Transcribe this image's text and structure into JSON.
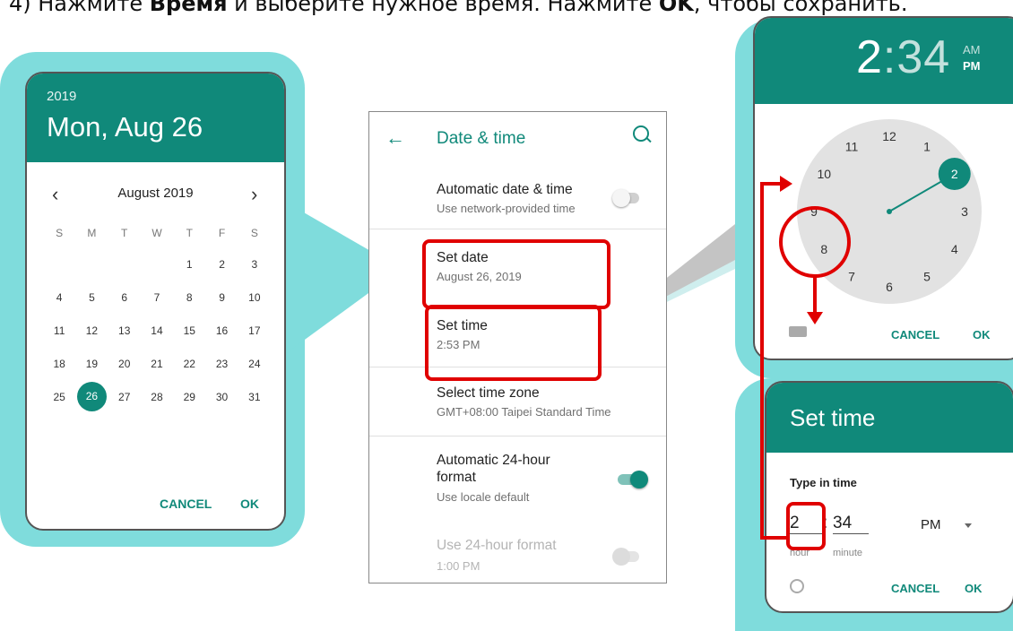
{
  "caption": {
    "prefix": "4) Нажмите ",
    "bold1": "Время",
    "middle": " и выберите нужное время. Нажмите ",
    "bold2": "OK",
    "suffix": ", чтобы сохранить."
  },
  "date_picker": {
    "year": "2019",
    "date": "Mon, Aug 26",
    "month_label": "August 2019",
    "weekdays": [
      "S",
      "M",
      "T",
      "W",
      "T",
      "F",
      "S"
    ],
    "weeks": [
      [
        "",
        "",
        "",
        "",
        "1",
        "2",
        "3"
      ],
      [
        "4",
        "5",
        "6",
        "7",
        "8",
        "9",
        "10"
      ],
      [
        "11",
        "12",
        "13",
        "14",
        "15",
        "16",
        "17"
      ],
      [
        "18",
        "19",
        "20",
        "21",
        "22",
        "23",
        "24"
      ],
      [
        "25",
        "26",
        "27",
        "28",
        "29",
        "30",
        "31"
      ]
    ],
    "selected_day": "26",
    "prev_icon": "‹",
    "next_icon": "›",
    "cancel": "CANCEL",
    "ok": "OK"
  },
  "settings": {
    "back_icon": "←",
    "title": "Date & time",
    "auto_date": {
      "label": "Automatic date & time",
      "sub": "Use network-provided time",
      "on": false
    },
    "set_date": {
      "label": "Set date",
      "sub": "August 26, 2019"
    },
    "set_time": {
      "label": "Set time",
      "sub": "2:53 PM"
    },
    "time_zone": {
      "label": "Select time zone",
      "sub": "GMT+08:00 Taipei Standard Time"
    },
    "auto_24": {
      "label1": "Automatic 24-hour",
      "label2": "format",
      "sub": "Use locale default",
      "on": true
    },
    "use_24": {
      "label": "Use 24-hour format",
      "sub": "1:00 PM",
      "enabled": false
    }
  },
  "clock_dialog": {
    "hour": "2",
    "colon": ":",
    "minute": "34",
    "am": "AM",
    "pm": "PM",
    "numbers": [
      "12",
      "1",
      "2",
      "3",
      "4",
      "5",
      "6",
      "7",
      "8",
      "9",
      "10",
      "11"
    ],
    "selected_hour": "2",
    "cancel": "CANCEL",
    "ok": "OK",
    "keyboard_icon": "keyboard-icon"
  },
  "time_input": {
    "title": "Set time",
    "type_label": "Type in time",
    "hour": "2",
    "colon": ":",
    "minute": "34",
    "hour_caption": "hour",
    "minute_caption": "minute",
    "period": "PM",
    "cancel": "CANCEL",
    "ok": "OK",
    "clock_icon": "clock-icon"
  },
  "colors": {
    "accent": "#10897a",
    "highlight": "#e00000",
    "frame": "#7fdcdc"
  }
}
